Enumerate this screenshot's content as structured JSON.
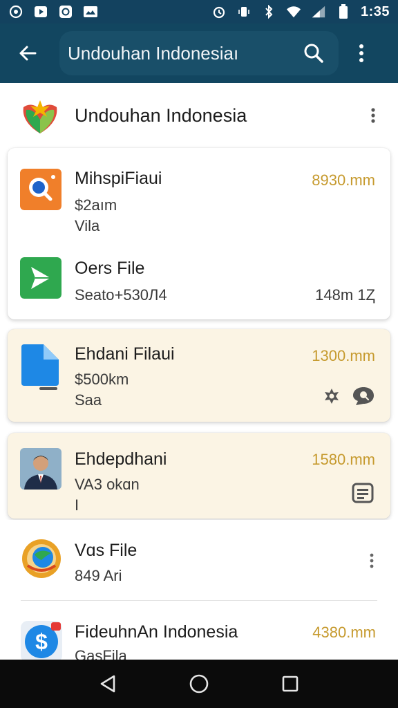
{
  "status_bar": {
    "time": "1:35",
    "left_icons": [
      "pinwheel-icon",
      "media-icon",
      "shield-icon",
      "photo-icon"
    ],
    "right_icons": [
      "alarm-icon",
      "vibrate-icon",
      "bluetooth-icon",
      "wifi-icon",
      "signal-icon",
      "battery-icon"
    ]
  },
  "app_bar": {
    "search_value": "Undouhan Indonesiaı"
  },
  "header": {
    "title": "Undouhan Indonesia"
  },
  "items": [
    {
      "title": "MihspiFiaui",
      "sub1": "$2aım",
      "sub2": "Vila",
      "time": "8930.mm",
      "icon": "search-app-icon",
      "color": "#f07f2a"
    },
    {
      "title": "Oers File",
      "sub1": "Seato+530Л4",
      "size": "148m 1Ⱬ",
      "icon": "send-app-icon",
      "color": "#2fa84f"
    },
    {
      "title": "Ehdani Filaui",
      "sub1": "$500km",
      "sub2": "Saa",
      "time": "1300.mm",
      "icon": "file-icon",
      "color": "#1e88e5"
    },
    {
      "title": "Ehdepdhani",
      "sub1": "VA3 okɑn",
      "sub2": "I",
      "time": "1580.mm",
      "icon": "avatar-photo",
      "color": "#2d3e5a"
    },
    {
      "title": "Vɑs File",
      "sub1": "849 Ari",
      "icon": "globe-app-icon",
      "color": "#e9a126"
    },
    {
      "title": "FideuhnAn Indonesia",
      "sub1": "GasFila",
      "time": "4380.mm",
      "icon": "dollar-app-icon",
      "color": "#1e88e5"
    }
  ],
  "colors": {
    "app_bar": "#124660",
    "status_bar": "#13425f",
    "time_accent": "#c69a2e",
    "cream_card": "#fbf4e4"
  }
}
